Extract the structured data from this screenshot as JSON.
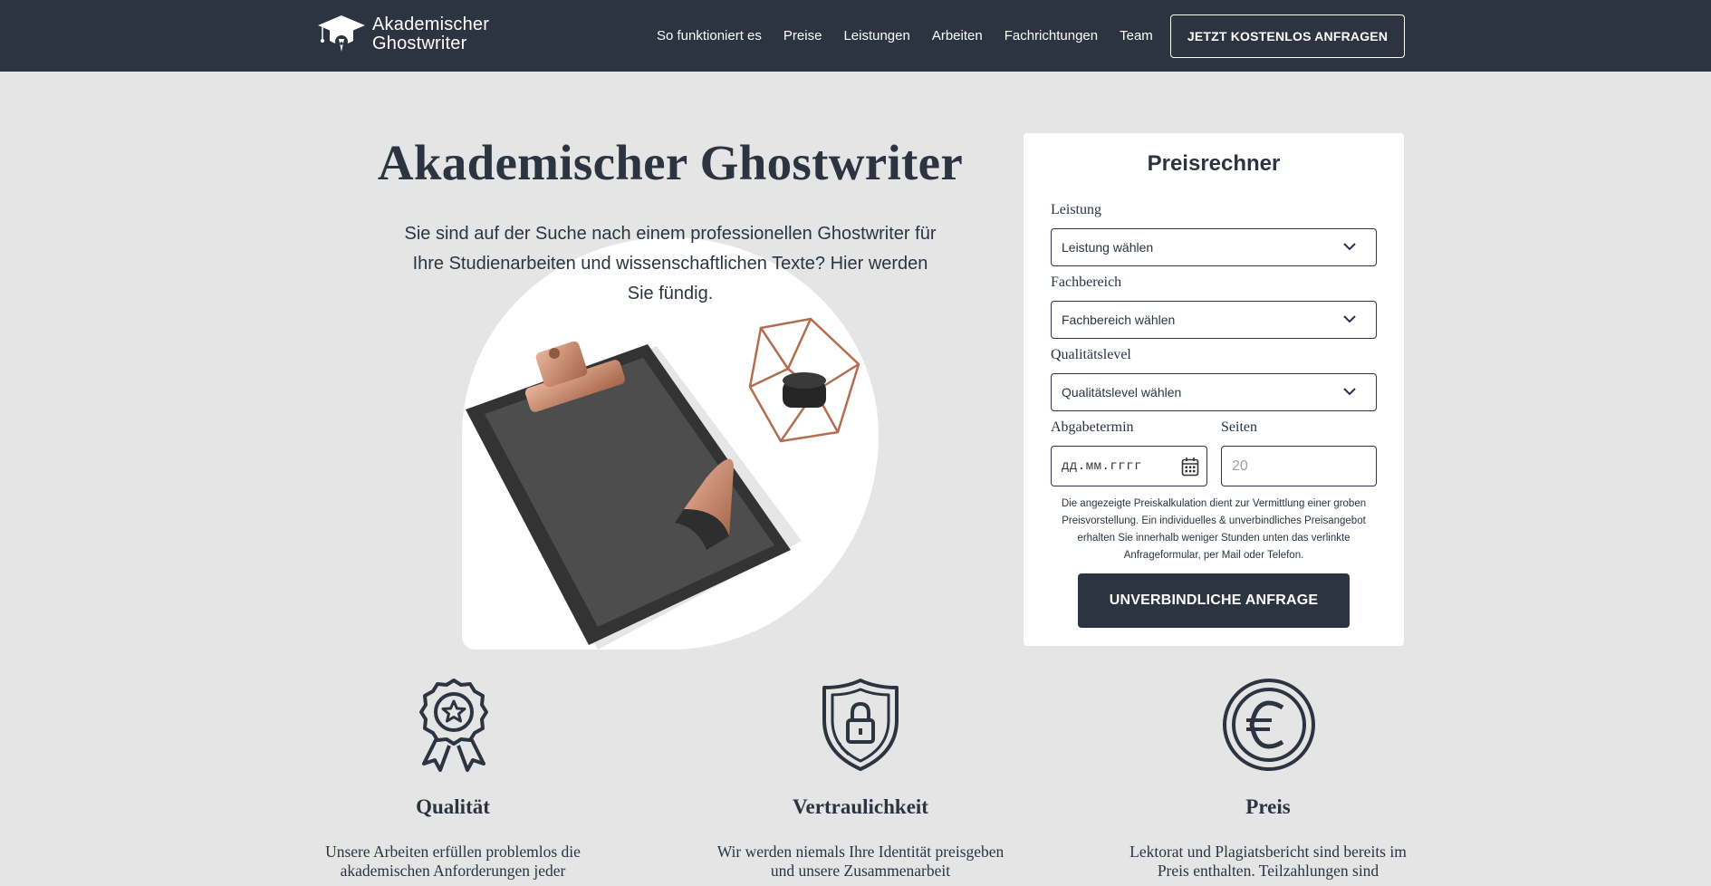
{
  "brand": {
    "line1": "Akademischer",
    "line2": "Ghostwriter",
    "icon": "graduation-cap-pen-icon"
  },
  "nav": [
    "So funktioniert es",
    "Preise",
    "Leistungen",
    "Arbeiten",
    "Fachrichtungen",
    "Team"
  ],
  "header_cta": "JETZT KOSTENLOS ANFRAGEN",
  "hero": {
    "title": "Akademischer Ghostwriter",
    "subtitle": "Sie sind auf der Suche nach einem professionellen Ghostwriter für Ihre Studienarbeiten und wissenschaftlichen Texte? Hier werden Sie fündig."
  },
  "calculator": {
    "title": "Preisrechner",
    "leistung": {
      "label": "Leistung",
      "value": "Leistung wählen"
    },
    "fachbereich": {
      "label": "Fachbereich",
      "value": "Fachbereich wählen"
    },
    "qualitaet": {
      "label": "Qualitätslevel",
      "value": "Qualitätslevel wählen"
    },
    "abgabe": {
      "label": "Abgabetermin",
      "placeholder": "дд.мм.гггг"
    },
    "seiten": {
      "label": "Seiten",
      "placeholder": "20"
    },
    "note": "Die angezeigte Preiskalkulation dient zur Vermittlung einer groben Preisvorstellung. Ein individuelles & unverbindliches Preisangebot erhalten Sie innerhalb weniger Stunden unten das verlinkte Anfrageformular, per Mail oder Telefon.",
    "button": "UNVERBINDLICHE ANFRAGE"
  },
  "features": [
    {
      "icon": "award-star-icon",
      "title": "Qualität",
      "text": "Unsere Arbeiten erfüllen problemlos die akademischen Anforderungen jeder"
    },
    {
      "icon": "shield-lock-icon",
      "title": "Vertraulichkeit",
      "text": "Wir werden niemals Ihre Identität preisgeben und unsere Zusammenarbeit"
    },
    {
      "icon": "euro-coin-icon",
      "title": "Preis",
      "text": "Lektorat und Plagiatsbericht sind bereits im Preis enthalten. Teilzahlungen sind"
    }
  ],
  "colors": {
    "navy": "#2b3440",
    "background": "#e5e5e5",
    "copper": "#c98b6c"
  }
}
